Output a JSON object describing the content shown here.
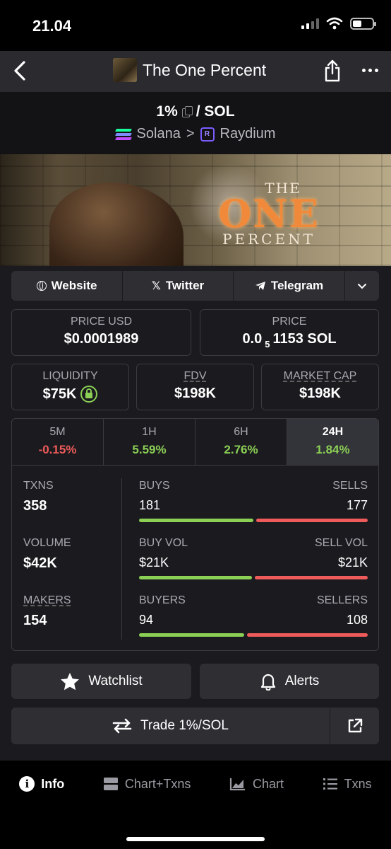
{
  "status": {
    "time": "21.04"
  },
  "header": {
    "title": "The One Percent"
  },
  "pair": {
    "base": "1%",
    "quote": "/ SOL",
    "chain": "Solana",
    "separator": ">",
    "dex": "Raydium"
  },
  "banner": {
    "line1": "THE",
    "line2": "ONE",
    "line3": "PERCENT"
  },
  "links": {
    "website": "Website",
    "twitter": "Twitter",
    "telegram": "Telegram"
  },
  "price": {
    "usd_label": "PRICE USD",
    "usd_value": "$0.0001989",
    "native_label": "PRICE",
    "native_prefix": "0.0",
    "native_sub": "5",
    "native_rest": "1153 SOL"
  },
  "stats": {
    "liquidity_label": "LIQUIDITY",
    "liquidity_value": "$75K",
    "fdv_label": "FDV",
    "fdv_value": "$198K",
    "mcap_label": "MARKET CAP",
    "mcap_value": "$198K"
  },
  "periods": [
    {
      "label": "5M",
      "value": "-0.15%",
      "trend": "neg"
    },
    {
      "label": "1H",
      "value": "5.59%",
      "trend": "pos"
    },
    {
      "label": "6H",
      "value": "2.76%",
      "trend": "pos"
    },
    {
      "label": "24H",
      "value": "1.84%",
      "trend": "pos",
      "active": true
    }
  ],
  "metrics": {
    "txns_label": "TXNS",
    "txns_value": "358",
    "volume_label": "VOLUME",
    "volume_value": "$42K",
    "makers_label": "MAKERS",
    "makers_value": "154"
  },
  "splits": {
    "buys_label": "BUYS",
    "sells_label": "SELLS",
    "buys": "181",
    "sells": "177",
    "buys_share": 0.506,
    "buyvol_label": "BUY VOL",
    "sellvol_label": "SELL VOL",
    "buyvol": "$21K",
    "sellvol": "$21K",
    "buyvol_share": 0.5,
    "buyers_label": "BUYERS",
    "sellers_label": "SELLERS",
    "buyers": "94",
    "sellers": "108",
    "buyers_share": 0.465
  },
  "actions": {
    "watchlist": "Watchlist",
    "alerts": "Alerts",
    "trade": "Trade 1%/SOL"
  },
  "nav": {
    "info": "Info",
    "chart_txns": "Chart+Txns",
    "chart": "Chart",
    "txns": "Txns"
  },
  "colors": {
    "positive": "#8bcf55",
    "negative": "#ef5a5a",
    "surface": "#2e2e33"
  }
}
